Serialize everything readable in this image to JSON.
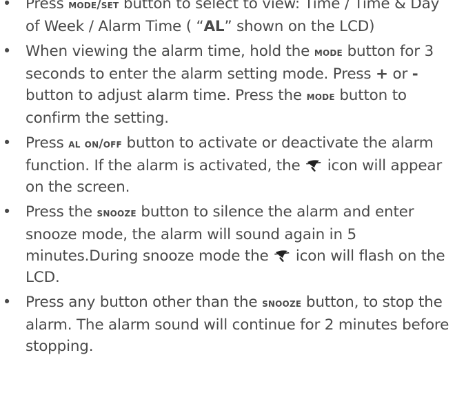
{
  "bullet_symbol": "•",
  "items": [
    {
      "p1": "Press ",
      "btn1": "MODE/SET",
      "p2": " button to select to view: Time / Time & Day of Week / Alarm Time ( “",
      "b1": "AL",
      "p3": "” shown on the LCD)"
    },
    {
      "p1": "When viewing the alarm time, hold the ",
      "btn1": "MODE",
      "p2": " button for 3 seconds to enter the alarm setting mode. Press ",
      "plus": "+",
      "p3": " or ",
      "minus": "-",
      "p4": " button to adjust alarm time. Press the ",
      "btn2": "MODE",
      "p5": " button to confirm the setting."
    },
    {
      "p1": "Press ",
      "btn1": "AL ON/OFF",
      "p2": " button to activate or deactivate the alarm function. If the alarm is activated, the ",
      "icon": "bell-icon",
      "p3": " icon will appear on the screen."
    },
    {
      "p1": "Press the ",
      "btn1": "SNOOZE",
      "p2": " button to silence the alarm and enter snooze mode, the alarm will sound again in 5 minutes.During snooze mode the ",
      "icon": "bell-icon",
      "p3": " icon will flash on the LCD."
    },
    {
      "p1": "Press any button other than the ",
      "btn1": "SNOOZE",
      "p2": " button, to stop the alarm. The alarm sound will continue for 2 minutes before stopping."
    }
  ]
}
